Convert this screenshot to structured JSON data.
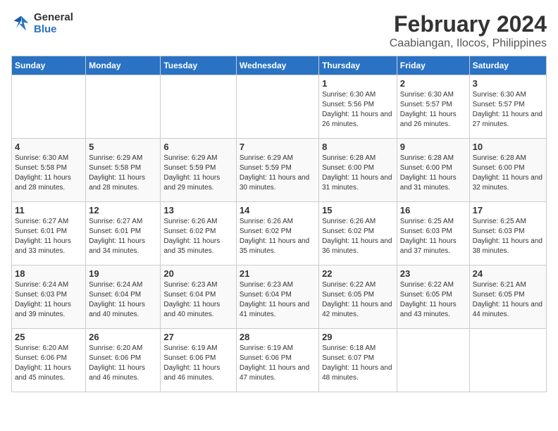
{
  "logo": {
    "line1": "General",
    "line2": "Blue"
  },
  "title": "February 2024",
  "subtitle": "Caabiangan, Ilocos, Philippines",
  "days_of_week": [
    "Sunday",
    "Monday",
    "Tuesday",
    "Wednesday",
    "Thursday",
    "Friday",
    "Saturday"
  ],
  "weeks": [
    [
      {
        "day": "",
        "info": ""
      },
      {
        "day": "",
        "info": ""
      },
      {
        "day": "",
        "info": ""
      },
      {
        "day": "",
        "info": ""
      },
      {
        "day": "1",
        "info": "Sunrise: 6:30 AM\nSunset: 5:56 PM\nDaylight: 11 hours and 26 minutes."
      },
      {
        "day": "2",
        "info": "Sunrise: 6:30 AM\nSunset: 5:57 PM\nDaylight: 11 hours and 26 minutes."
      },
      {
        "day": "3",
        "info": "Sunrise: 6:30 AM\nSunset: 5:57 PM\nDaylight: 11 hours and 27 minutes."
      }
    ],
    [
      {
        "day": "4",
        "info": "Sunrise: 6:30 AM\nSunset: 5:58 PM\nDaylight: 11 hours and 28 minutes."
      },
      {
        "day": "5",
        "info": "Sunrise: 6:29 AM\nSunset: 5:58 PM\nDaylight: 11 hours and 28 minutes."
      },
      {
        "day": "6",
        "info": "Sunrise: 6:29 AM\nSunset: 5:59 PM\nDaylight: 11 hours and 29 minutes."
      },
      {
        "day": "7",
        "info": "Sunrise: 6:29 AM\nSunset: 5:59 PM\nDaylight: 11 hours and 30 minutes."
      },
      {
        "day": "8",
        "info": "Sunrise: 6:28 AM\nSunset: 6:00 PM\nDaylight: 11 hours and 31 minutes."
      },
      {
        "day": "9",
        "info": "Sunrise: 6:28 AM\nSunset: 6:00 PM\nDaylight: 11 hours and 31 minutes."
      },
      {
        "day": "10",
        "info": "Sunrise: 6:28 AM\nSunset: 6:00 PM\nDaylight: 11 hours and 32 minutes."
      }
    ],
    [
      {
        "day": "11",
        "info": "Sunrise: 6:27 AM\nSunset: 6:01 PM\nDaylight: 11 hours and 33 minutes."
      },
      {
        "day": "12",
        "info": "Sunrise: 6:27 AM\nSunset: 6:01 PM\nDaylight: 11 hours and 34 minutes."
      },
      {
        "day": "13",
        "info": "Sunrise: 6:26 AM\nSunset: 6:02 PM\nDaylight: 11 hours and 35 minutes."
      },
      {
        "day": "14",
        "info": "Sunrise: 6:26 AM\nSunset: 6:02 PM\nDaylight: 11 hours and 35 minutes."
      },
      {
        "day": "15",
        "info": "Sunrise: 6:26 AM\nSunset: 6:02 PM\nDaylight: 11 hours and 36 minutes."
      },
      {
        "day": "16",
        "info": "Sunrise: 6:25 AM\nSunset: 6:03 PM\nDaylight: 11 hours and 37 minutes."
      },
      {
        "day": "17",
        "info": "Sunrise: 6:25 AM\nSunset: 6:03 PM\nDaylight: 11 hours and 38 minutes."
      }
    ],
    [
      {
        "day": "18",
        "info": "Sunrise: 6:24 AM\nSunset: 6:03 PM\nDaylight: 11 hours and 39 minutes."
      },
      {
        "day": "19",
        "info": "Sunrise: 6:24 AM\nSunset: 6:04 PM\nDaylight: 11 hours and 40 minutes."
      },
      {
        "day": "20",
        "info": "Sunrise: 6:23 AM\nSunset: 6:04 PM\nDaylight: 11 hours and 40 minutes."
      },
      {
        "day": "21",
        "info": "Sunrise: 6:23 AM\nSunset: 6:04 PM\nDaylight: 11 hours and 41 minutes."
      },
      {
        "day": "22",
        "info": "Sunrise: 6:22 AM\nSunset: 6:05 PM\nDaylight: 11 hours and 42 minutes."
      },
      {
        "day": "23",
        "info": "Sunrise: 6:22 AM\nSunset: 6:05 PM\nDaylight: 11 hours and 43 minutes."
      },
      {
        "day": "24",
        "info": "Sunrise: 6:21 AM\nSunset: 6:05 PM\nDaylight: 11 hours and 44 minutes."
      }
    ],
    [
      {
        "day": "25",
        "info": "Sunrise: 6:20 AM\nSunset: 6:06 PM\nDaylight: 11 hours and 45 minutes."
      },
      {
        "day": "26",
        "info": "Sunrise: 6:20 AM\nSunset: 6:06 PM\nDaylight: 11 hours and 46 minutes."
      },
      {
        "day": "27",
        "info": "Sunrise: 6:19 AM\nSunset: 6:06 PM\nDaylight: 11 hours and 46 minutes."
      },
      {
        "day": "28",
        "info": "Sunrise: 6:19 AM\nSunset: 6:06 PM\nDaylight: 11 hours and 47 minutes."
      },
      {
        "day": "29",
        "info": "Sunrise: 6:18 AM\nSunset: 6:07 PM\nDaylight: 11 hours and 48 minutes."
      },
      {
        "day": "",
        "info": ""
      },
      {
        "day": "",
        "info": ""
      }
    ]
  ]
}
